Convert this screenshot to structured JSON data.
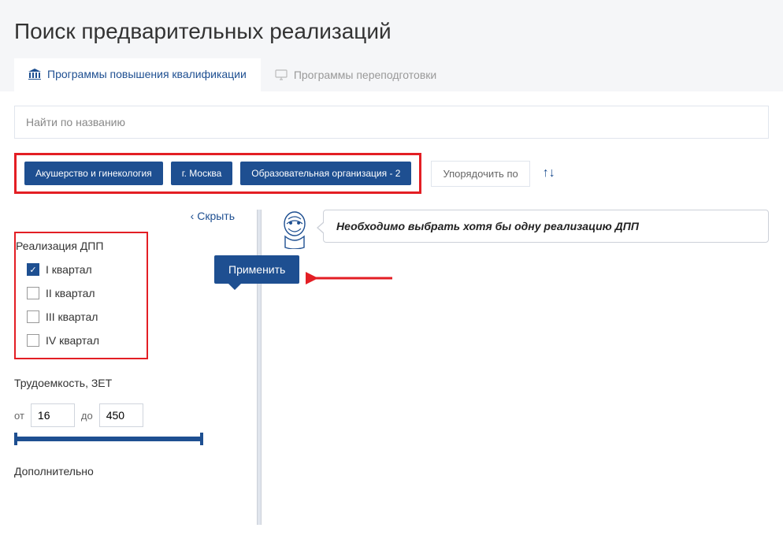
{
  "page_title": "Поиск предварительных реализаций",
  "tabs": [
    {
      "label": "Программы повышения квалификации",
      "active": true
    },
    {
      "label": "Программы переподготовки",
      "active": false
    }
  ],
  "search": {
    "placeholder": "Найти по названию"
  },
  "filters": {
    "chips": [
      "Акушерство и гинекология",
      "г. Москва",
      "Образовательная организация - 2"
    ],
    "sort_label": "Упорядочить по"
  },
  "sidebar": {
    "collapse_label": "Скрыть",
    "apply_label": "Применить",
    "realization": {
      "title": "Реализация ДПП",
      "options": [
        {
          "label": "I квартал",
          "checked": true
        },
        {
          "label": "II квартал",
          "checked": false
        },
        {
          "label": "III квартал",
          "checked": false
        },
        {
          "label": "IV квартал",
          "checked": false
        }
      ]
    },
    "labor": {
      "title": "Трудоемкость, ЗЕТ",
      "from_label": "от",
      "from_value": "16",
      "to_label": "до",
      "to_value": "450"
    },
    "extra_title": "Дополнительно"
  },
  "notice": {
    "text": "Необходимо выбрать хотя бы одну реализацию ДПП"
  }
}
